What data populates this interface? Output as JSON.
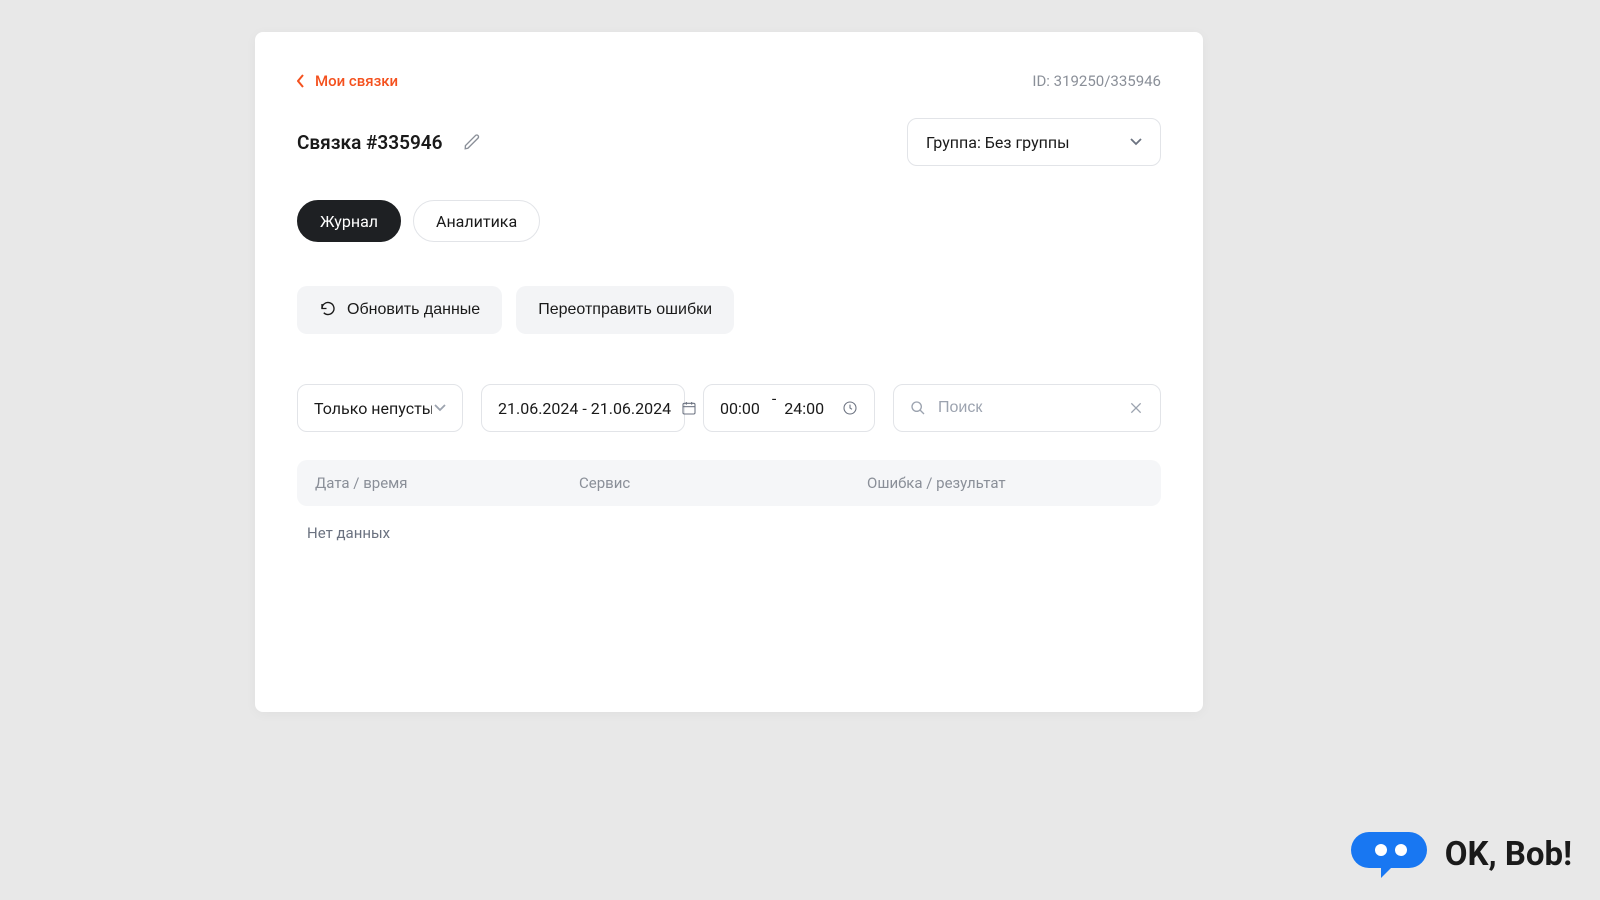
{
  "header": {
    "back_label": "Мои связки",
    "id_label": "ID: 319250/335946"
  },
  "title": "Связка #335946",
  "group_select": {
    "label": "Группа: Без группы"
  },
  "tabs": {
    "journal": "Журнал",
    "analytics": "Аналитика",
    "active": "journal"
  },
  "actions": {
    "refresh": "Обновить данные",
    "resend_errors": "Переотправить ошибки"
  },
  "filters": {
    "nonempty_select": "Только непустые",
    "date_from": "21.06.2024",
    "date_to": "21.06.2024",
    "time_from": "00:00",
    "time_to": "24:00",
    "search_placeholder": "Поиск"
  },
  "table": {
    "columns": {
      "date": "Дата / время",
      "service": "Сервис",
      "error": "Ошибка / результат"
    },
    "empty_message": "Нет данных",
    "rows": []
  },
  "watermark": "OK, Bob!"
}
